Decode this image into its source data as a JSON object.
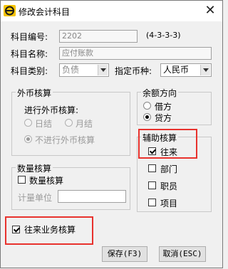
{
  "window": {
    "title": "修改会计科目",
    "app_icon": "e-logo-icon",
    "close_label": "✕"
  },
  "fields": {
    "code": {
      "label": "科目编号:",
      "value": "2202",
      "hint": "(4-3-3-3)"
    },
    "name": {
      "label": "科目名称:",
      "value": "应付账款"
    },
    "category": {
      "label": "科目类别:",
      "value": "负债"
    },
    "currency": {
      "label": "指定币种:",
      "value": "人民币"
    }
  },
  "foreign": {
    "title": "外币核算",
    "label": "进行外币核算:",
    "daily": "日结",
    "monthly": "月结",
    "none": "不进行外币核算"
  },
  "balance": {
    "title": "余额方向",
    "debit": "借方",
    "credit": "贷方"
  },
  "quantity": {
    "title": "数量核算",
    "check": "数量核算",
    "unit_label": "计量单位"
  },
  "aux": {
    "title": "辅助核算",
    "items": [
      "往来",
      "部门",
      "职员",
      "项目"
    ]
  },
  "intercourse": "往来业务核算",
  "buttons": {
    "save": "保存(F3)",
    "cancel": "取消(ESC)"
  },
  "colors": {
    "highlight": "#e8322d",
    "icon_yellow": "#f5c400"
  }
}
